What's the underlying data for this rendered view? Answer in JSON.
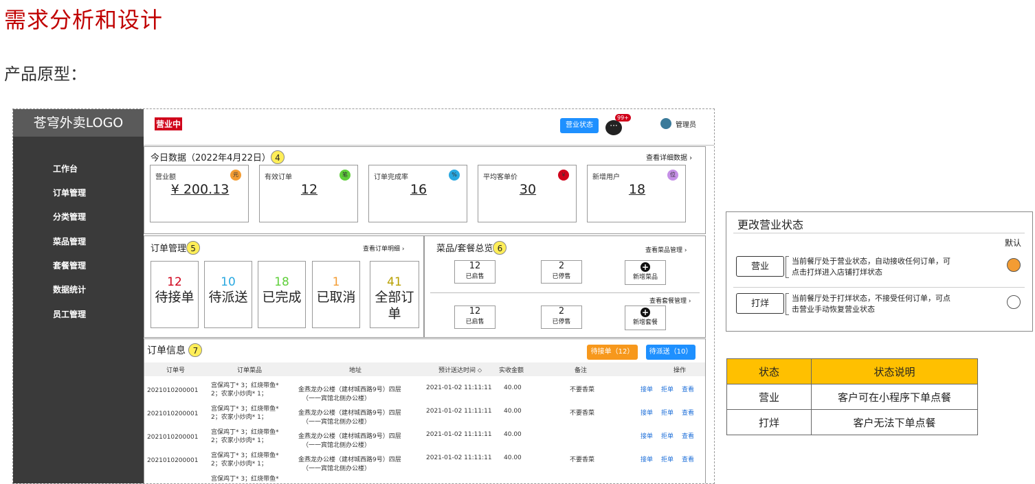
{
  "heading": "需求分析和设计",
  "subheading": "产品原型：",
  "app": {
    "logo": "苍穹外卖LOGO",
    "status_badge": "营业中",
    "status_button": "营业状态",
    "msg_badge": "99+",
    "admin": "管理员",
    "nav": [
      "工作台",
      "订单管理",
      "分类管理",
      "菜品管理",
      "套餐管理",
      "数据统计",
      "员工管理"
    ]
  },
  "today": {
    "title": "今日数据（2022年4月22日）",
    "num": "4",
    "link": "查看详细数据",
    "cards": [
      {
        "label": "营业额",
        "value": "¥ 200.13",
        "icon": "元",
        "color": "#f39c33"
      },
      {
        "label": "有效订单",
        "value": "12",
        "icon": "笔",
        "color": "#5fcf3a"
      },
      {
        "label": "订单完成率",
        "value": "16",
        "icon": "%",
        "color": "#29a8e0"
      },
      {
        "label": "平均客单价",
        "value": "30",
        "icon": "￥",
        "color": "#d0021b"
      },
      {
        "label": "新增用户",
        "value": "18",
        "icon": "位",
        "color": "#c58fe6"
      }
    ]
  },
  "orders": {
    "title": "订单管理",
    "num": "5",
    "link": "查看订单明细",
    "items": [
      {
        "count": "12",
        "label": "待接单",
        "color": "#d0021b"
      },
      {
        "count": "10",
        "label": "待派送",
        "color": "#29a8e0"
      },
      {
        "count": "18",
        "label": "已完成",
        "color": "#5fcf3a"
      },
      {
        "count": "1",
        "label": "已取消",
        "color": "#f39c33"
      },
      {
        "count": "41",
        "label": "全部订单",
        "color": "#b8a000"
      }
    ]
  },
  "dishes": {
    "title": "菜品/套餐总览",
    "num": "6",
    "dish_link": "查看菜品管理",
    "set_link": "查看套餐管理",
    "dish": {
      "on_count": "12",
      "on_label": "已启售",
      "off_count": "2",
      "off_label": "已停售",
      "add": "新增菜品"
    },
    "set": {
      "on_count": "12",
      "on_label": "已启售",
      "off_count": "2",
      "off_label": "已停售",
      "add": "新增套餐"
    }
  },
  "info": {
    "title": "订单信息",
    "num": "7",
    "btn_pending": "待接单（12）",
    "btn_delivery": "待派送（10）",
    "columns": [
      "订单号",
      "订单菜品",
      "地址",
      "预计送达时间",
      "实收金额",
      "备注",
      "操作"
    ],
    "rows": [
      {
        "id": "2021010200001",
        "dish1": "宫保鸡丁* 3；红烧带鱼*",
        "dish2": "2；农家小炒肉* 1；",
        "addr1": "金燕龙办公楼（建材城西路9号）四层",
        "addr2": "（一一宾馆北侧办公楼）",
        "time": "2021-01-02 11:11:11",
        "amount": "40.00",
        "note": "不要香菜"
      },
      {
        "id": "2021010200001",
        "dish1": "宫保鸡丁* 3；红烧带鱼*",
        "dish2": "2；农家小炒肉* 1；",
        "addr1": "金燕龙办公楼（建材城西路9号）四层",
        "addr2": "（一一宾馆北侧办公楼）",
        "time": "2021-01-02 11:11:11",
        "amount": "40.00",
        "note": "不要香菜"
      },
      {
        "id": "2021010200001",
        "dish1": "宫保鸡丁* 3；红烧带鱼*",
        "dish2": "2；农家小炒肉* 1；",
        "addr1": "金燕龙办公楼（建材城西路9号）四层",
        "addr2": "（一一宾馆北侧办公楼）",
        "time": "2021-01-02 11:11:11",
        "amount": "40.00",
        "note": ""
      },
      {
        "id": "2021010200001",
        "dish1": "宫保鸡丁* 3；红烧带鱼*",
        "dish2": "2；农家小炒肉* 1；",
        "addr1": "金燕龙办公楼（建材城西路9号）四层",
        "addr2": "（一一宾馆北侧办公楼）",
        "time": "2021-01-02 11:11:11",
        "amount": "40.00",
        "note": "不要香菜"
      },
      {
        "id": "",
        "dish1": "宫保鸡丁* 3；红烧带鱼*",
        "dish2": "",
        "addr1": "",
        "addr2": "",
        "time": "",
        "amount": "",
        "note": ""
      }
    ],
    "ops": [
      "接单",
      "拒单",
      "查看"
    ]
  },
  "status_panel": {
    "title": "更改营业状态",
    "default_label": "默认",
    "options": [
      {
        "button": "营业",
        "desc1": "当前餐厅处于营业状态，自动接收任何订单，可",
        "desc2": "点击打烊进入店铺打烊状态",
        "selected": true
      },
      {
        "button": "打烊",
        "desc1": "当前餐厅处于打烊状态，不接受任何订单，可点",
        "desc2": "击营业手动恢复营业状态",
        "selected": false
      }
    ]
  },
  "status_table": {
    "headers": [
      "状态",
      "状态说明"
    ],
    "rows": [
      [
        "营业",
        "客户可在小程序下单点餐"
      ],
      [
        "打烊",
        "客户无法下单点餐"
      ]
    ],
    "header_color": "#ffc000"
  }
}
